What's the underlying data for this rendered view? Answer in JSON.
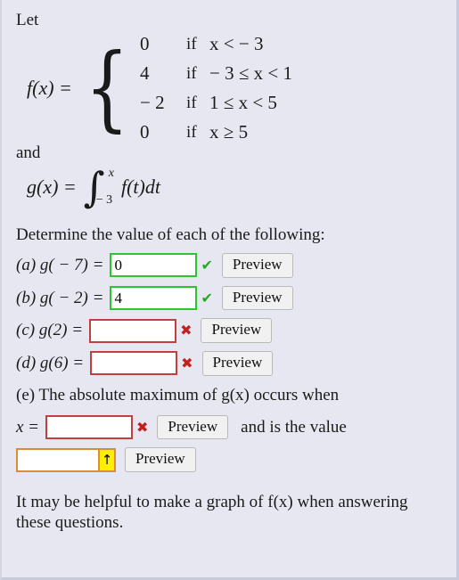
{
  "problem": {
    "let_label": "Let",
    "function_name": "f(x) =",
    "piecewise": [
      {
        "value": "0",
        "if": "if",
        "condition_lhs": "x",
        "relation": "<",
        "condition_rhs": "− 3"
      },
      {
        "value": "4",
        "if": "if",
        "condition_lhs": "− 3 ≤ x",
        "relation": "<",
        "condition_rhs": "1"
      },
      {
        "value": "− 2",
        "if": "if",
        "condition_lhs": "1 ≤ x",
        "relation": "<",
        "condition_rhs": "5"
      },
      {
        "value": "0",
        "if": "if",
        "condition_lhs": "x",
        "relation": "≥",
        "condition_rhs": "5"
      }
    ],
    "piecewise_rows": [
      {
        "value": "0",
        "if": "if",
        "condition": "x < − 3"
      },
      {
        "value": "4",
        "if": "if",
        "condition": "− 3 ≤ x < 1"
      },
      {
        "value": "− 2",
        "if": "if",
        "condition": "1 ≤ x < 5"
      },
      {
        "value": "0",
        "if": "if",
        "condition": "x ≥ 5"
      }
    ],
    "and_label": "and",
    "integral": {
      "lhs": "g(x) =",
      "integral_sign": "∫",
      "upper_limit": "x",
      "lower_limit": "− 3",
      "integrand": "f(t)dt"
    }
  },
  "instructions": "Determine the value of each of the following:",
  "questions": [
    {
      "label": "(a) g( − 7) =",
      "value": "0",
      "placeholder": "",
      "state": "correct",
      "mark": "✔",
      "preview_label": "Preview"
    },
    {
      "label": "(b) g( − 2) =",
      "value": "4",
      "placeholder": "",
      "state": "correct",
      "mark": "✔",
      "preview_label": "Preview"
    },
    {
      "label": "(c) g(2) =",
      "value": "",
      "placeholder": "",
      "state": "wrong",
      "mark": "✖",
      "preview_label": "Preview"
    },
    {
      "label": "(d) g(6) =",
      "value": "",
      "placeholder": "",
      "state": "wrong",
      "mark": "✖",
      "preview_label": "Preview"
    }
  ],
  "part_e": {
    "prompt": "(e) The absolute maximum of g(x) occurs when",
    "x_label": "x =",
    "x_value": "",
    "x_placeholder": "",
    "x_state": "wrong",
    "x_mark": "✖",
    "x_preview_label": "Preview",
    "middle_text": "and is the value",
    "value_input": "",
    "value_placeholder": "",
    "value_state": "pending",
    "value_arrow": "↑",
    "value_preview_label": "Preview"
  },
  "footer_note": "It may be helpful to make a graph of f(x) when answering these questions.",
  "colors": {
    "background": "#e7e7f1",
    "correct_border": "#2ec62e",
    "wrong_border": "#c04040",
    "pending_border": "#dd8c33",
    "arrow_box": "#ffee00",
    "check_mark": "#22aa22",
    "cross_mark": "#c02020",
    "button_bg": "#f1f1f1"
  }
}
